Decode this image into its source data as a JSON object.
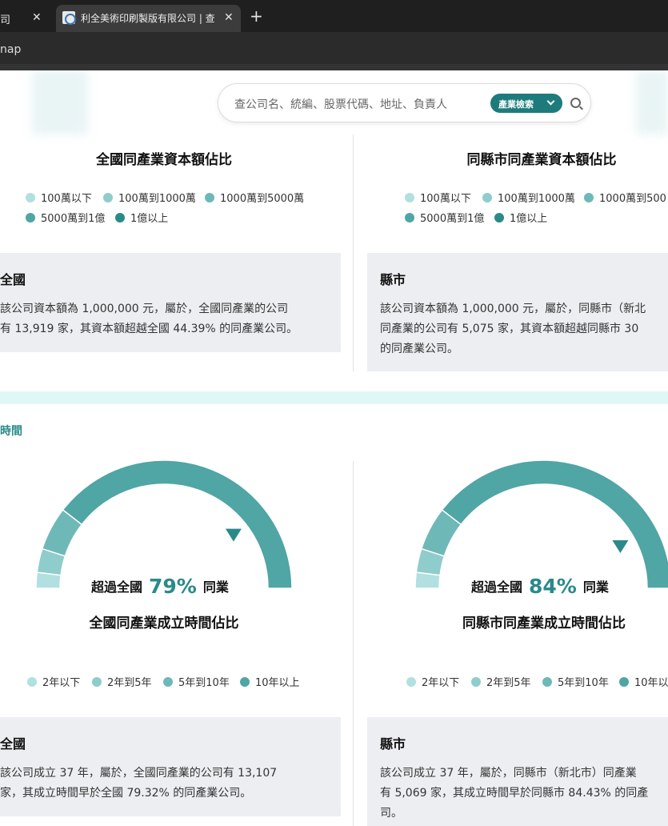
{
  "browser": {
    "inactive_tab_title": "司",
    "active_tab_title": "利全美術印刷製版有限公司 | 查",
    "address_fragment": "nap",
    "new_tab_label": "+",
    "close_label": "✕"
  },
  "search": {
    "placeholder": "查公司名、統編、股票代碼、地址、負責人",
    "industry_button": "產業檢索"
  },
  "capital": {
    "national_title": "全國同產業資本額佔比",
    "county_title": "同縣市同產業資本額佔比",
    "legend": [
      {
        "label": "100萬以下",
        "color": "#b2dfdf"
      },
      {
        "label": "100萬到1000萬",
        "color": "#8fcccc"
      },
      {
        "label": "1000萬到5000萬",
        "color": "#6fb8b8"
      },
      {
        "label": "5000萬到1億",
        "color": "#50a5a5"
      },
      {
        "label": "1億以上",
        "color": "#2a8a8a"
      }
    ],
    "county_legend_item3": "1000萬到500",
    "national_box": {
      "heading": "全國",
      "lines": [
        "該公司資本額為 1,000,000 元，屬於，全國同產業的公司",
        "有 13,919 家，其資本額超越全國 44.39% 的同產業公司。"
      ]
    },
    "county_box": {
      "heading": "縣市",
      "lines": [
        "該公司資本額為 1,000,000 元，屬於，同縣市（新北",
        "同產業的公司有 5,075 家，其資本額超越同縣市 30",
        "的同產業公司。"
      ]
    }
  },
  "founding": {
    "section_label": "時間",
    "national": {
      "caption_prefix": "超過全國",
      "percent": "79%",
      "caption_suffix": "同業",
      "value": 79,
      "title": "全國同產業成立時間佔比"
    },
    "county": {
      "caption_prefix": "超過全國",
      "percent": "84%",
      "caption_suffix": "同業",
      "value": 84,
      "title": "同縣市同產業成立時間佔比"
    },
    "legend": [
      {
        "label": "2年以下",
        "color": "#b2dfdf"
      },
      {
        "label": "2年到5年",
        "color": "#8fcccc"
      },
      {
        "label": "5年到10年",
        "color": "#6fb8b8"
      },
      {
        "label": "10年以上",
        "color": "#50a5a5"
      }
    ],
    "county_legend_item4": "10年以",
    "national_box": {
      "heading": "全國",
      "lines": [
        "該公司成立 37 年，屬於，全國同產業的公司有 13,107",
        "家，其成立時間早於全國 79.32% 的同產業公司。"
      ]
    },
    "county_box": {
      "heading": "縣市",
      "lines": [
        "該公司成立 37 年，屬於，同縣市（新北市）同產業",
        "有 5,069 家，其成立時間早於同縣市 84.43% 的同產",
        "司。"
      ]
    }
  }
}
